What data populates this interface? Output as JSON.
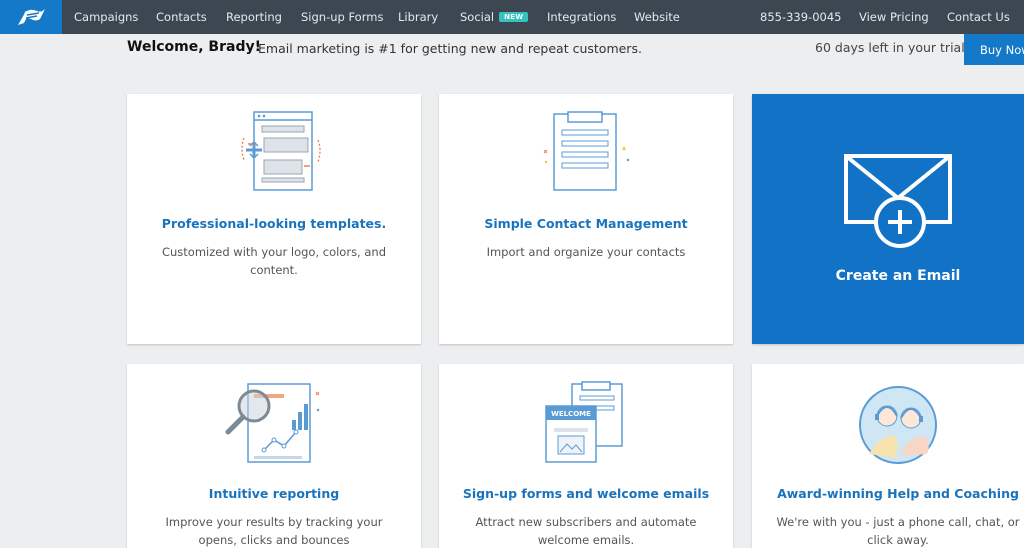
{
  "nav": {
    "items": [
      {
        "label": "Campaigns"
      },
      {
        "label": "Contacts"
      },
      {
        "label": "Reporting"
      },
      {
        "label": "Sign-up Forms"
      },
      {
        "label": "Library"
      },
      {
        "label": "Social",
        "badge": "NEW"
      },
      {
        "label": "Integrations"
      },
      {
        "label": "Website"
      }
    ],
    "phone": "855-339-0045",
    "pricing": "View Pricing",
    "contact": "Contact Us"
  },
  "welcome": {
    "greeting": "Welcome, Brady!",
    "message": "Email marketing is #1 for getting new and repeat customers.",
    "trial": "60 days left in your trial",
    "buy_label": "Buy Now"
  },
  "cards": [
    {
      "title": "Professional-looking templates.",
      "desc": "Customized with your logo, colors, and content.",
      "icon": "template-icon"
    },
    {
      "title": "Simple Contact Management",
      "desc": "Import and organize your contacts",
      "icon": "contact-list-icon"
    },
    {
      "title": "Create an Email",
      "icon": "envelope-plus-icon"
    },
    {
      "title": "Intuitive reporting",
      "desc": "Improve your results by tracking your opens, clicks and bounces",
      "icon": "reporting-icon"
    },
    {
      "title": "Sign-up forms and welcome emails",
      "desc": "Attract new subscribers and automate welcome emails.",
      "icon_text": "WELCOME",
      "icon": "signup-form-icon"
    },
    {
      "title": "Award-winning Help and Coaching",
      "desc": "We're with you - just a phone call, chat, or click away.",
      "icon": "support-agents-icon"
    }
  ],
  "colors": {
    "brand_blue": "#1479c8",
    "nav_bg": "#3d4752",
    "link_blue": "#1a73bd",
    "badge_teal": "#36c3c0"
  }
}
